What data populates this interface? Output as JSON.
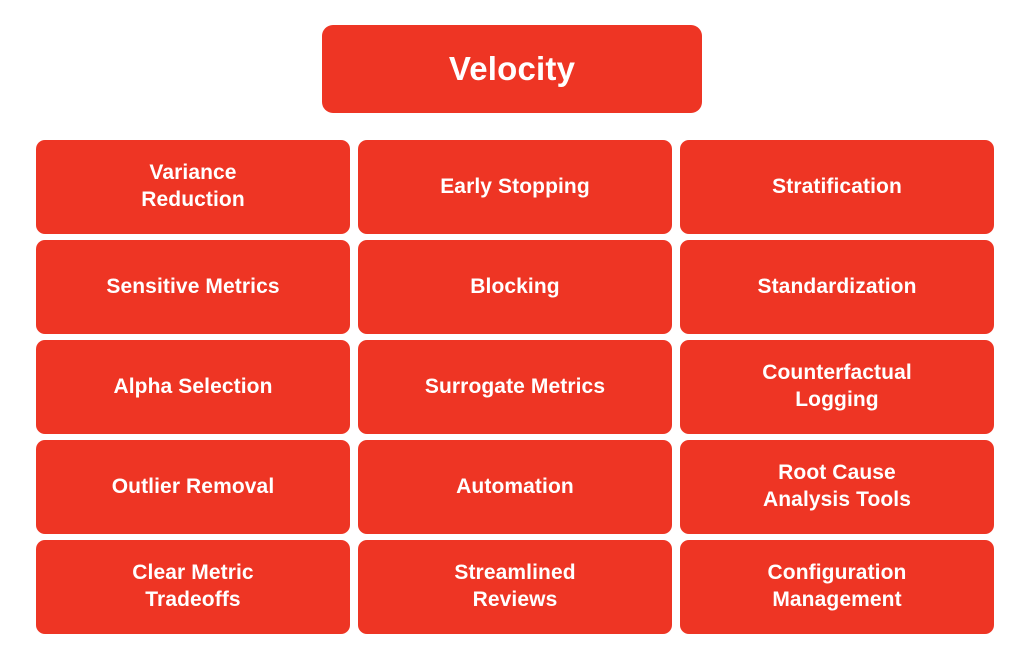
{
  "theme": {
    "node_color": "#EE3524",
    "text_color": "#FFFFFF",
    "background_color": "#FFFFFF"
  },
  "diagram": {
    "type": "hierarchy-grid",
    "root": {
      "label": "Velocity"
    },
    "columns": 3,
    "rows": 5,
    "nodes": [
      [
        {
          "label": "Variance\nReduction"
        },
        {
          "label": "Early Stopping"
        },
        {
          "label": "Stratification"
        }
      ],
      [
        {
          "label": "Sensitive Metrics"
        },
        {
          "label": "Blocking"
        },
        {
          "label": "Standardization"
        }
      ],
      [
        {
          "label": "Alpha Selection"
        },
        {
          "label": "Surrogate Metrics"
        },
        {
          "label": "Counterfactual\nLogging"
        }
      ],
      [
        {
          "label": "Outlier Removal"
        },
        {
          "label": "Automation"
        },
        {
          "label": "Root Cause\nAnalysis Tools"
        }
      ],
      [
        {
          "label": "Clear Metric\nTradeoffs"
        },
        {
          "label": "Streamlined\nReviews"
        },
        {
          "label": "Configuration\nManagement"
        }
      ]
    ]
  }
}
